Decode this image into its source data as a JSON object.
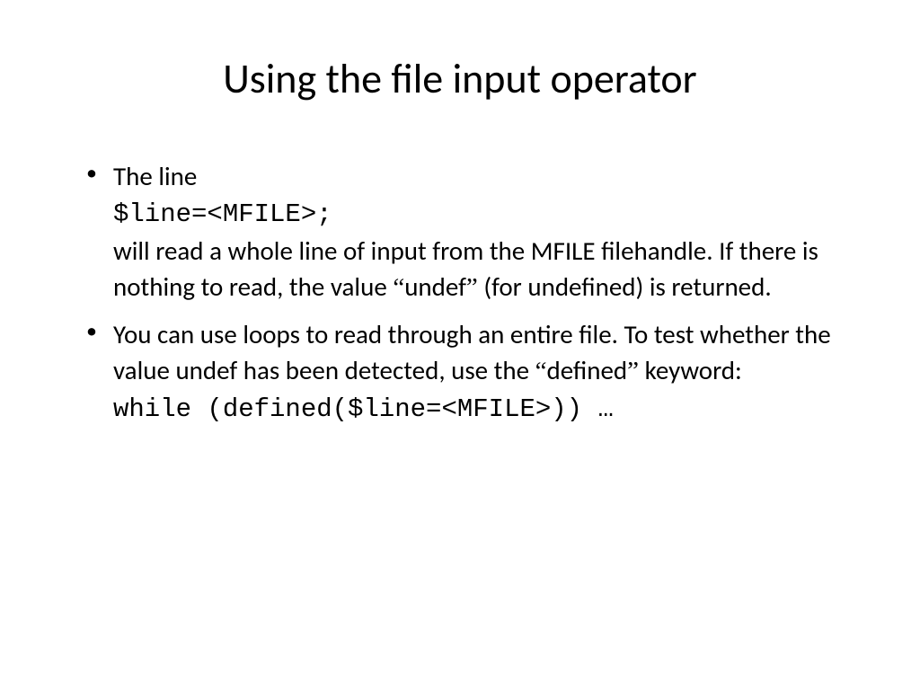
{
  "slide": {
    "title": "Using the file input operator",
    "bullets": [
      {
        "part1": "The line",
        "code1": "$line=<MFILE>;",
        "part2": "will read a whole line of input from the MFILE filehandle. If there is nothing to read, the value ",
        "lquote1": "“",
        "word1": "undef",
        "rquote1": "”",
        "part3": " (for undefined) is returned."
      },
      {
        "part1": "You can use loops to read through an entire file. To test whether the value undef has been detected, use the ",
        "lquote1": "“",
        "word1": "defined",
        "rquote1": "”",
        "part2": " keyword:",
        "code1": "while (defined($line=<MFILE>)) …"
      }
    ]
  }
}
